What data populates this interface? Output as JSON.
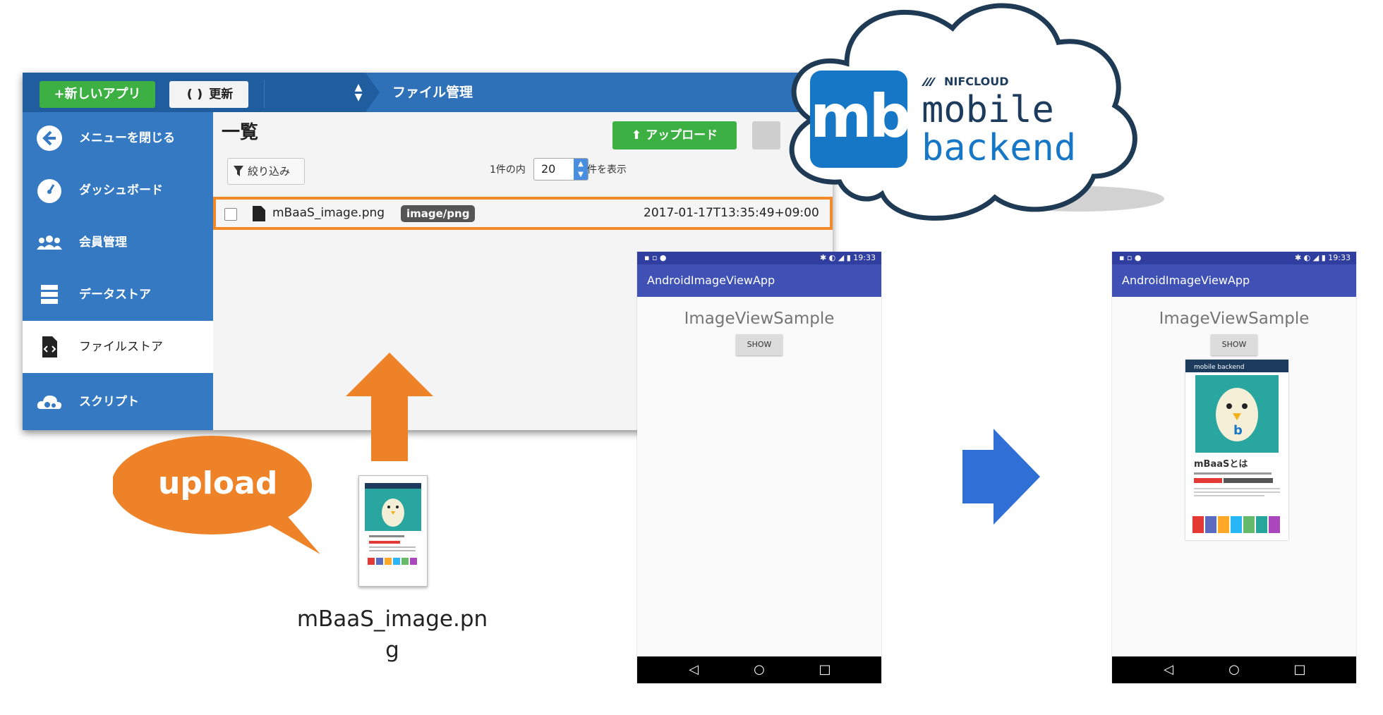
{
  "console": {
    "new_app_button": "+新しいアプリ",
    "refresh_button": "更新",
    "breadcrumb": "ファイル管理",
    "sidebar": {
      "items": [
        {
          "label": "メニューを閉じる",
          "icon": "arrow-left-circle-icon"
        },
        {
          "label": "ダッシュボード",
          "icon": "gauge-icon"
        },
        {
          "label": "会員管理",
          "icon": "users-icon"
        },
        {
          "label": "データストア",
          "icon": "database-icon"
        },
        {
          "label": "ファイルストア",
          "icon": "code-file-icon",
          "active": true
        },
        {
          "label": "スクリプト",
          "icon": "cloud-gear-icon"
        }
      ]
    },
    "list_title": "一覧",
    "upload_button": "アップロード",
    "filter_button": "絞り込み",
    "paging_prefix": "1件の内",
    "per_page_value": "20",
    "paging_suffix": "件を表示",
    "file_row": {
      "filename": "mBaaS_image.png",
      "type": "image/png",
      "date": "2017-01-17T13:35:49+09:00"
    }
  },
  "cloud_logo": {
    "mark": "mb",
    "brand_small": "NIFCLOUD",
    "line1": "mobile",
    "line2": "backend"
  },
  "upload_bubble": "upload",
  "local_file_name": "mBaaS_image.png",
  "phones": [
    {
      "time": "19:33",
      "app_title": "AndroidImageViewApp",
      "heading": "ImageViewSample",
      "show_button": "SHOW"
    },
    {
      "time": "19:33",
      "app_title": "AndroidImageViewApp",
      "heading": "ImageViewSample",
      "show_button": "SHOW",
      "image_caption": "mBaaSとは",
      "image_header": "mobile backend"
    }
  ],
  "colors": {
    "console_topbar": "#1f5d9e",
    "sidebar": "#3479c2",
    "green_button": "#3cb043",
    "highlight_orange": "#f28a2a",
    "android_appbar": "#3f51b5",
    "mb_blue": "#1677c6",
    "arrow_blue": "#2f6fd6"
  }
}
